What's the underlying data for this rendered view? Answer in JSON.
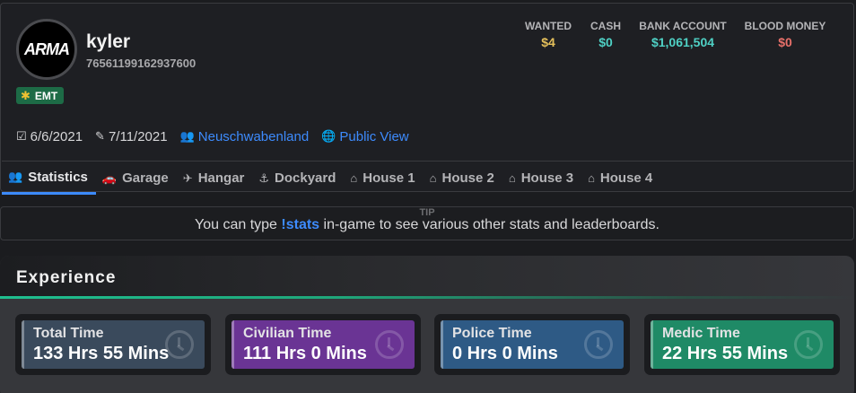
{
  "profile": {
    "avatar_logo": "ARMA",
    "username": "kyler",
    "steam_id": "76561199162937600",
    "role_badge": "EMT",
    "role_icon": "asterisk-icon"
  },
  "stats": [
    {
      "label": "WANTED",
      "value": "$4",
      "color": "#e5c05b"
    },
    {
      "label": "CASH",
      "value": "$0",
      "color": "#4fd1c5"
    },
    {
      "label": "BANK ACCOUNT",
      "value": "$1,061,504",
      "color": "#4fd1c5"
    },
    {
      "label": "BLOOD MONEY",
      "value": "$0",
      "color": "#e8706a"
    }
  ],
  "meta": {
    "joined_date": "6/6/2021",
    "last_seen_date": "7/11/2021",
    "group": "Neuschwabenland",
    "public_view": "Public View"
  },
  "tabs": [
    {
      "label": "Statistics",
      "icon": "users-icon",
      "active": true
    },
    {
      "label": "Garage",
      "icon": "car-icon"
    },
    {
      "label": "Hangar",
      "icon": "helicopter-icon"
    },
    {
      "label": "Dockyard",
      "icon": "anchor-icon"
    },
    {
      "label": "House 1",
      "icon": "warehouse-icon"
    },
    {
      "label": "House 2",
      "icon": "warehouse-icon"
    },
    {
      "label": "House 3",
      "icon": "warehouse-icon"
    },
    {
      "label": "House 4",
      "icon": "warehouse-icon"
    }
  ],
  "tip": {
    "label": "TIP",
    "text_before": "You can type ",
    "command": "!stats",
    "text_after": " in-game to see various other stats and leaderboards."
  },
  "experience": {
    "title": "Experience",
    "cards": [
      {
        "label": "Total Time",
        "value": "133 Hrs 55 Mins",
        "color": "#3a4a5c"
      },
      {
        "label": "Civilian Time",
        "value": "111 Hrs 0 Mins",
        "color": "#6a3494"
      },
      {
        "label": "Police Time",
        "value": "0 Hrs 0 Mins",
        "color": "#2e5a85"
      },
      {
        "label": "Medic Time",
        "value": "22 Hrs 55 Mins",
        "color": "#1f8a66"
      }
    ]
  }
}
